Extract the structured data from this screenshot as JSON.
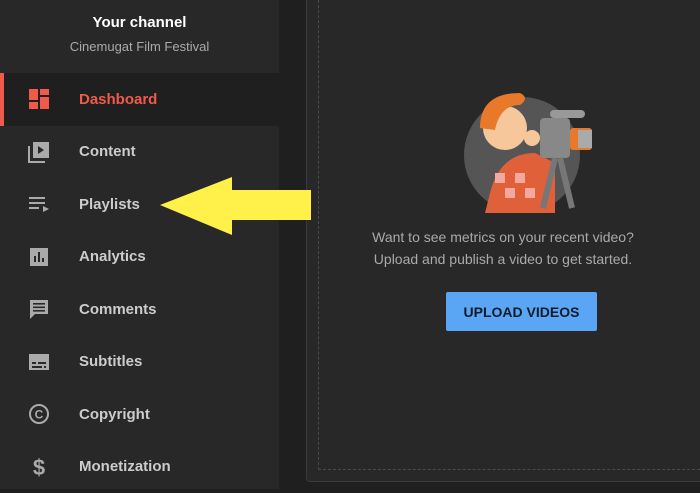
{
  "sidebar": {
    "title": "Your channel",
    "channel_name": "Cinemugat Film Festival",
    "items": [
      {
        "label": "Dashboard",
        "icon": "dashboard-icon",
        "active": true
      },
      {
        "label": "Content",
        "icon": "content-icon"
      },
      {
        "label": "Playlists",
        "icon": "playlists-icon"
      },
      {
        "label": "Analytics",
        "icon": "analytics-icon"
      },
      {
        "label": "Comments",
        "icon": "comments-icon"
      },
      {
        "label": "Subtitles",
        "icon": "subtitles-icon"
      },
      {
        "label": "Copyright",
        "icon": "copyright-icon"
      },
      {
        "label": "Monetization",
        "icon": "monetization-icon"
      }
    ]
  },
  "main": {
    "message_line1": "Want to see metrics on your recent video?",
    "message_line2": "Upload and publish a video to get started.",
    "upload_button": "UPLOAD VIDEOS"
  },
  "colors": {
    "accent": "#f05a4a",
    "button": "#5aa6f5",
    "arrow": "#fff04a"
  }
}
